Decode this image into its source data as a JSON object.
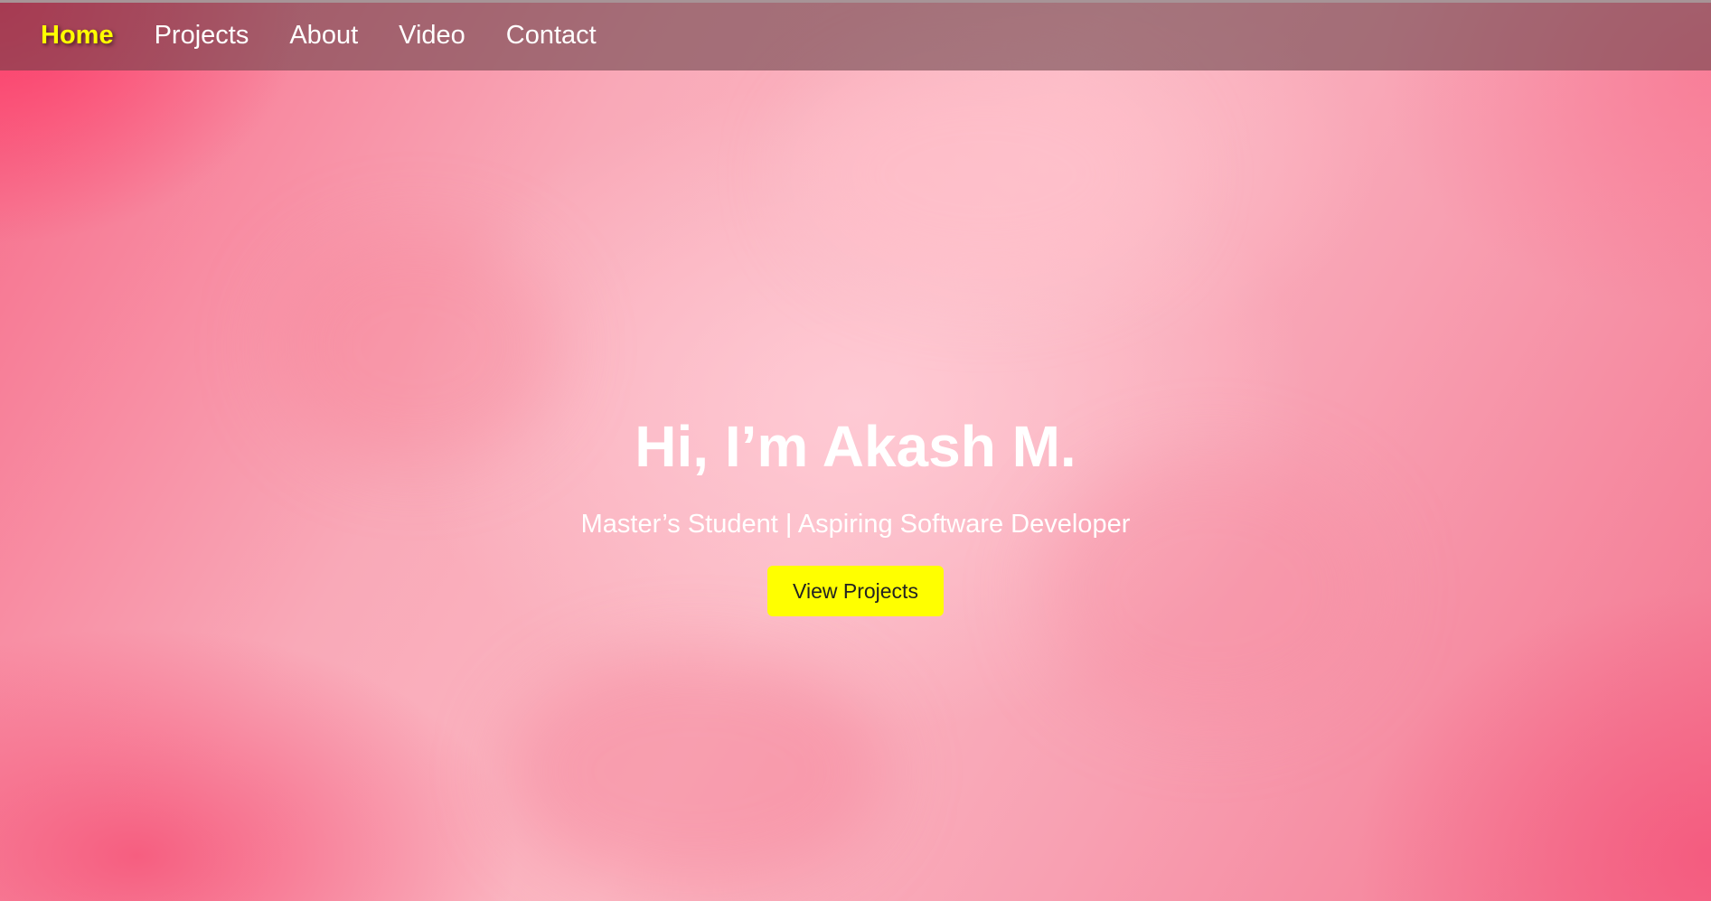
{
  "nav": {
    "items": [
      {
        "label": "Home",
        "active": true
      },
      {
        "label": "Projects",
        "active": false
      },
      {
        "label": "About",
        "active": false
      },
      {
        "label": "Video",
        "active": false
      },
      {
        "label": "Contact",
        "active": false
      }
    ]
  },
  "hero": {
    "title": "Hi, I’m Akash M.",
    "subtitle": "Master’s Student | Aspiring Software Developer",
    "cta_label": "View Projects"
  },
  "colors": {
    "accent": "#ffff00",
    "background": "#f9a9b8",
    "nav_background": "#5f3c41"
  }
}
